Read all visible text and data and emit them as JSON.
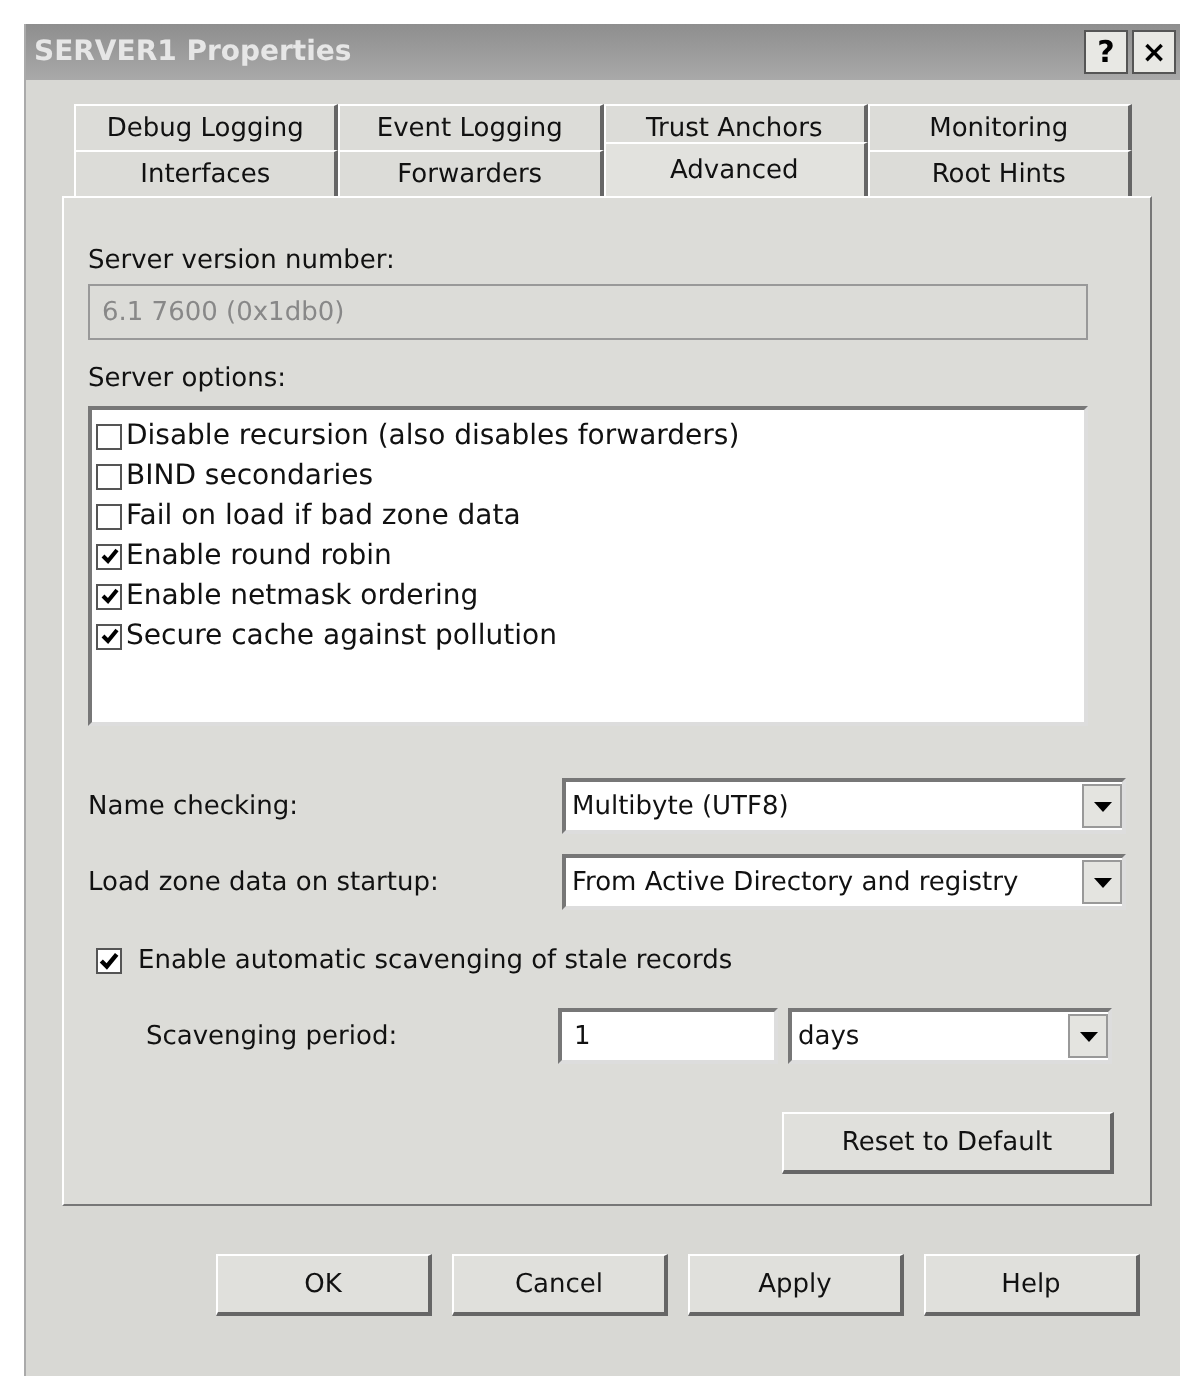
{
  "window": {
    "title": "SERVER1 Properties",
    "help_button": "?",
    "close_button": "×"
  },
  "tab_rows": [
    [
      {
        "label": "Debug Logging",
        "selected": false
      },
      {
        "label": "Event Logging",
        "selected": false
      },
      {
        "label": "Trust Anchors",
        "selected": false
      },
      {
        "label": "Monitoring",
        "selected": false
      }
    ],
    [
      {
        "label": "Interfaces",
        "selected": false
      },
      {
        "label": "Forwarders",
        "selected": false
      },
      {
        "label": "Advanced",
        "selected": true
      },
      {
        "label": "Root Hints",
        "selected": false
      }
    ]
  ],
  "server_version": {
    "label": "Server version number:",
    "value": "6.1 7600 (0x1db0)",
    "disabled": true
  },
  "server_options": {
    "label": "Server options:",
    "items": [
      {
        "label": "Disable recursion (also disables forwarders)",
        "checked": false
      },
      {
        "label": "BIND secondaries",
        "checked": false
      },
      {
        "label": "Fail on load if bad zone data",
        "checked": false
      },
      {
        "label": "Enable round robin",
        "checked": true
      },
      {
        "label": "Enable netmask ordering",
        "checked": true
      },
      {
        "label": "Secure cache against pollution",
        "checked": true
      }
    ]
  },
  "name_checking": {
    "label": "Name checking:",
    "value": "Multibyte (UTF8)"
  },
  "load_zone_data": {
    "label": "Load zone data on startup:",
    "value": "From Active Directory and registry"
  },
  "scavenging": {
    "label": "Enable automatic scavenging of stale records",
    "checked": true,
    "period_label": "Scavenging period:",
    "period_value": "1",
    "unit": "days"
  },
  "reset_button": "Reset to Default",
  "buttons": [
    "OK",
    "Cancel",
    "Apply",
    "Help"
  ]
}
